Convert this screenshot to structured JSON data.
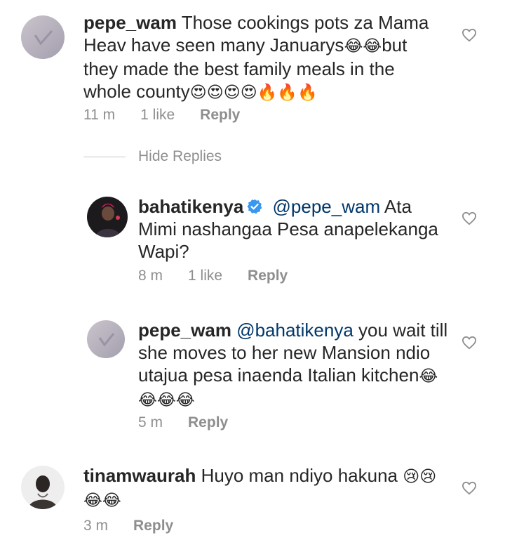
{
  "comments": [
    {
      "username": "pepe_wam",
      "text_line1": " Those cookings pots za Mama",
      "text_line2_a": "Heav have seen many Januarys",
      "text_line2_emoji": "😂😂",
      "text_line2_b": "but",
      "text_line3": "they made the best family meals in the",
      "text_line4": "whole county",
      "text_line4_emoji": "😍😍😍😍🔥🔥🔥",
      "time": "11 m",
      "likes": "1 like",
      "reply": "Reply",
      "avatar_icon": "gray-placeholder-avatar"
    }
  ],
  "hide_replies": "Hide Replies",
  "replies": [
    {
      "username": "bahatikenya",
      "mention": "@pepe_wam",
      "text_line1_rest": " Ata",
      "text_line2": "Mimi nashangaa Pesa anapelekanga",
      "text_line3": "Wapi?",
      "time": "8 m",
      "likes": "1 like",
      "reply": "Reply",
      "verified_icon": "verified-badge-icon"
    },
    {
      "username": "pepe_wam",
      "mention": "@bahatikenya",
      "text_line1_rest": " you wait till",
      "text_line2": "she moves to her new Mansion ndio",
      "text_line3": "utajua pesa inaenda Italian kitchen",
      "text_line3_emoji": "😂",
      "text_line4_emoji": "😂😂😂",
      "time": "5 m",
      "reply": "Reply"
    }
  ],
  "last_comment": {
    "username": "tinamwaurah",
    "text_line1": " Huyo man ndiyo hakuna ",
    "text_line1_emoji": "😢😢",
    "text_line2_emoji": "😂😂",
    "time": "3 m",
    "reply": "Reply"
  },
  "colors": {
    "text": "#262626",
    "secondary": "#8e8e8e",
    "mention": "#00376b",
    "verified": "#3897f0"
  }
}
